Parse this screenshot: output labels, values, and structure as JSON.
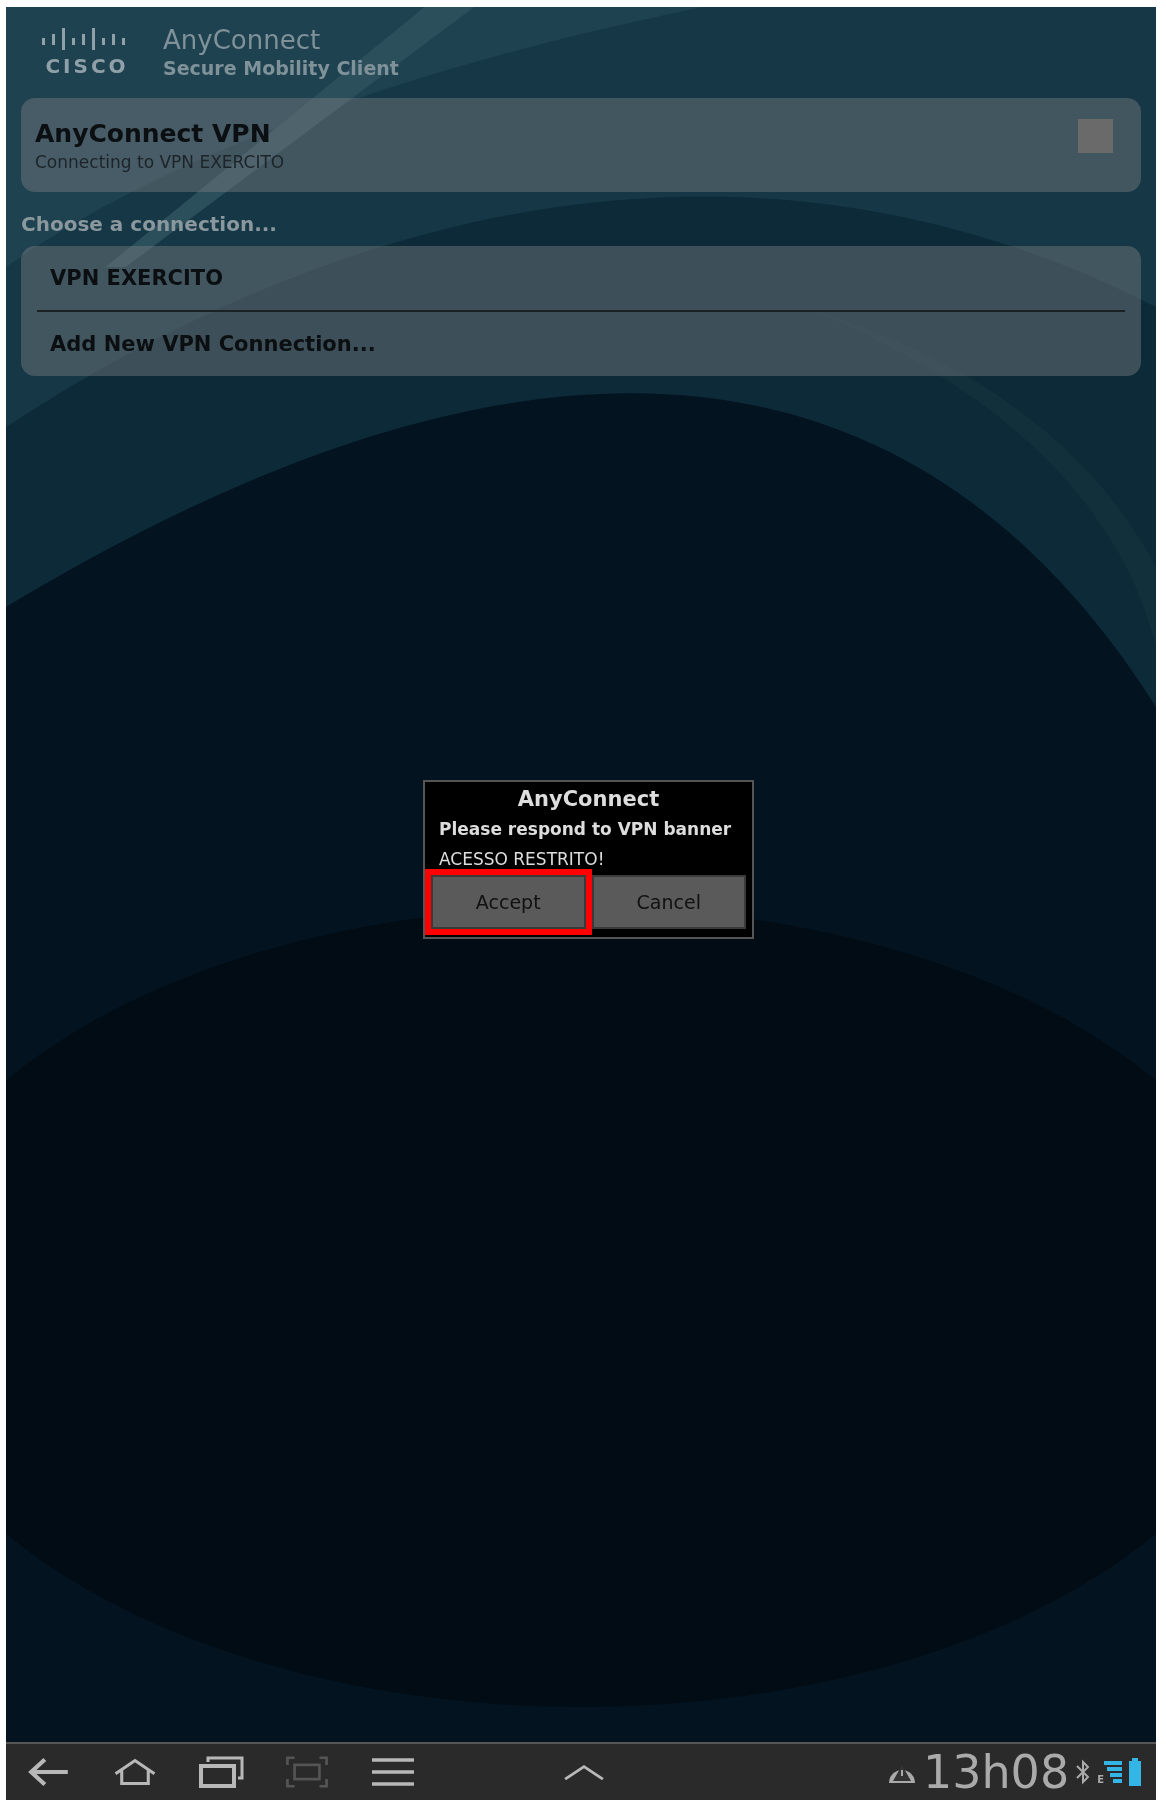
{
  "header": {
    "logo_text": "CISCO",
    "app_name": "AnyConnect",
    "app_subtitle": "Secure Mobility Client"
  },
  "vpn_card": {
    "title": "AnyConnect VPN",
    "status": "Connecting to VPN EXERCITO",
    "on": false
  },
  "section_label": "Choose a connection...",
  "connections": [
    {
      "label": "VPN EXERCITO"
    },
    {
      "label": "Add New VPN Connection..."
    }
  ],
  "dialog": {
    "title": "AnyConnect",
    "message": "Please respond to VPN banner",
    "banner": "ACESSO RESTRITO!",
    "buttons": [
      {
        "label": "Accept",
        "highlighted": true
      },
      {
        "label": "Cancel",
        "highlighted": false
      }
    ]
  },
  "system_bar": {
    "time": "13h08",
    "network_type": "E"
  }
}
